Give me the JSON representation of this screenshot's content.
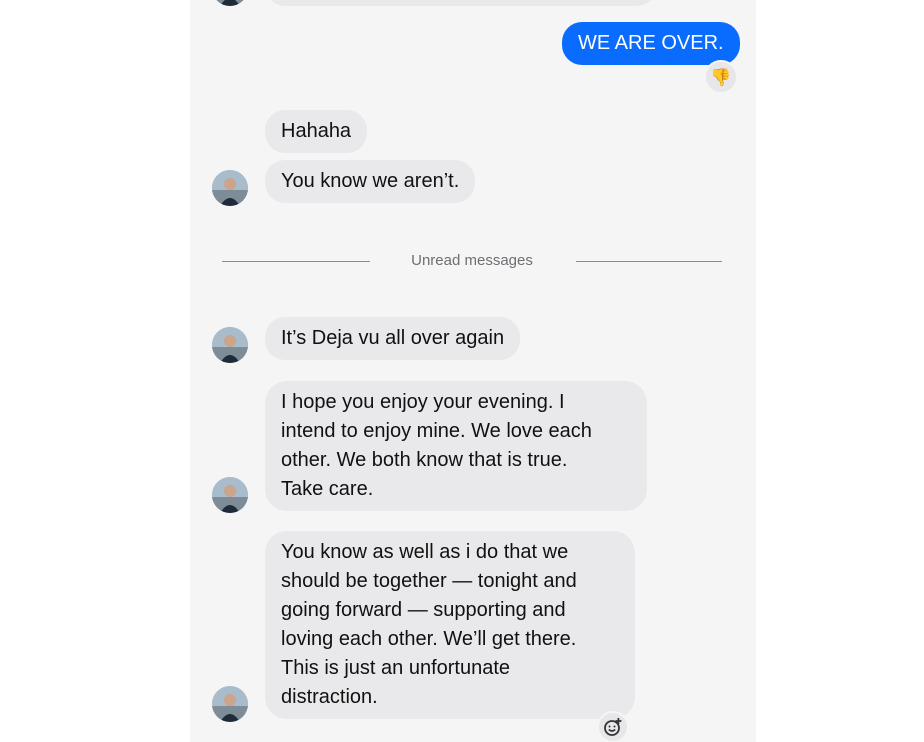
{
  "messages": {
    "outgoing_1": "WE ARE OVER.",
    "incoming_1": "Hahaha",
    "incoming_2": "You know we aren’t.",
    "incoming_3": "It’s Deja vu all over again",
    "incoming_4": "I hope you enjoy your evening. I\nintend to enjoy mine. We love each\nother. We both know that is true.\nTake care.",
    "incoming_5": "You know as well as i do that we\nshould be together — tonight and\ngoing forward — supporting and\nloving each other. We’ll get there.\nThis is just an unfortunate\ndistraction."
  },
  "divider": {
    "label": "Unread messages"
  },
  "reactions": {
    "outgoing_1": "👎"
  },
  "colors": {
    "outgoing_bubble": "#0a6cff",
    "incoming_bubble": "#e9e9eb",
    "panel_background": "#f5f5f6"
  },
  "icons": {
    "reaction": "thumbs-down-icon",
    "add_reaction": "add-reaction-icon"
  }
}
